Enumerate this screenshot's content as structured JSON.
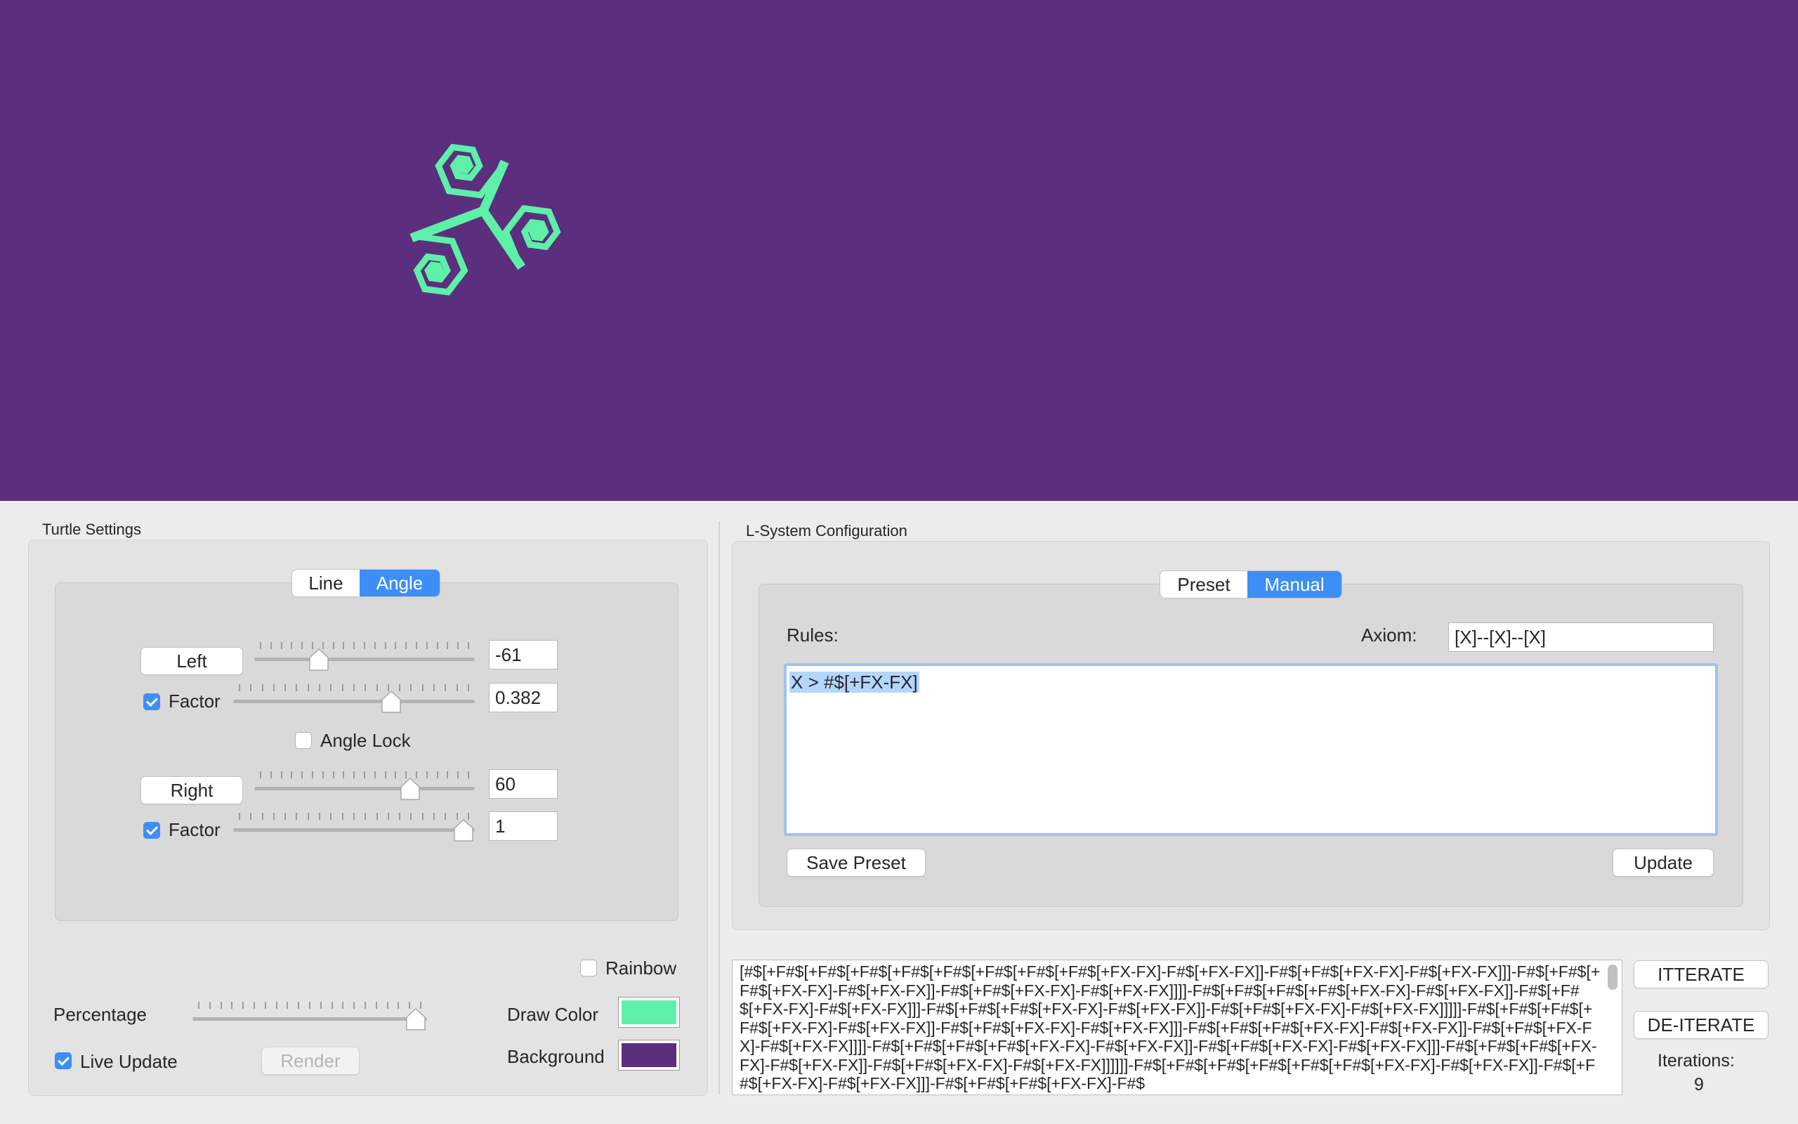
{
  "canvas": {
    "background": "#5b2f7e",
    "draw_color": "#5ef0a8"
  },
  "turtle": {
    "title": "Turtle Settings",
    "segment": {
      "options": [
        "Line",
        "Angle"
      ],
      "selected": "Angle"
    },
    "left": {
      "button": "Left",
      "value": "-61",
      "slider_fraction": 0.27
    },
    "left_factor": {
      "label": "Factor",
      "checked": true,
      "value": "0.382",
      "slider_fraction": 0.67
    },
    "angle_lock": {
      "label": "Angle Lock",
      "checked": false
    },
    "right": {
      "button": "Right",
      "value": "60",
      "slider_fraction": 0.73
    },
    "right_factor": {
      "label": "Factor",
      "checked": true,
      "value": "1",
      "slider_fraction": 1.0
    },
    "rainbow": {
      "label": "Rainbow",
      "checked": false
    },
    "percentage": {
      "label": "Percentage",
      "slider_fraction": 1.0
    },
    "draw_color": {
      "label": "Draw Color",
      "color": "#5ef0a8"
    },
    "background": {
      "label": "Background",
      "color": "#5b2f7e"
    },
    "live_update": {
      "label": "Live Update",
      "checked": true
    },
    "render_button": "Render"
  },
  "lsystem": {
    "title": "L-System Configuration",
    "segment": {
      "options": [
        "Preset",
        "Manual"
      ],
      "selected": "Manual"
    },
    "rules_label": "Rules:",
    "axiom_label": "Axiom:",
    "axiom_value": "[X]--[X]--[X]",
    "rules_value": "X > #$[+FX-FX]",
    "save_preset": "Save Preset",
    "update": "Update"
  },
  "output": {
    "text": "[#$[+F#$[+F#$[+F#$[+F#$[+F#$[+F#$[+F#$[+F#$[+FX-FX]-F#$[+FX-FX]]-F#$[+F#$[+FX-FX]-F#$[+FX-FX]]]-F#$[+F#$[+F#$[+FX-FX]-F#$[+FX-FX]]-F#$[+F#$[+FX-FX]-F#$[+FX-FX]]]]-F#$[+F#$[+F#$[+F#$[+FX-FX]-F#$[+FX-FX]]-F#$[+F#$[+FX-FX]-F#$[+FX-FX]]]-F#$[+F#$[+F#$[+FX-FX]-F#$[+FX-FX]]-F#$[+F#$[+FX-FX]-F#$[+FX-FX]]]]]-F#$[+F#$[+F#$[+F#$[+FX-FX]-F#$[+FX-FX]]-F#$[+F#$[+FX-FX]-F#$[+FX-FX]]]-F#$[+F#$[+F#$[+FX-FX]-F#$[+FX-FX]]-F#$[+F#$[+FX-FX]-F#$[+FX-FX]]]]-F#$[+F#$[+F#$[+F#$[+FX-FX]-F#$[+FX-FX]]-F#$[+F#$[+FX-FX]-F#$[+FX-FX]]]-F#$[+F#$[+F#$[+FX-FX]-F#$[+FX-FX]]-F#$[+F#$[+FX-FX]-F#$[+FX-FX]]]]]]-F#$[+F#$[+F#$[+F#$[+F#$[+F#$[+FX-FX]-F#$[+FX-FX]]-F#$[+F#$[+FX-FX]-F#$[+FX-FX]]]-F#$[+F#$[+F#$[+FX-FX]-F#$",
    "iterate": "ITTERATE",
    "deiterate": "DE-ITERATE",
    "iterations_label": "Iterations:",
    "iterations_value": "9"
  }
}
